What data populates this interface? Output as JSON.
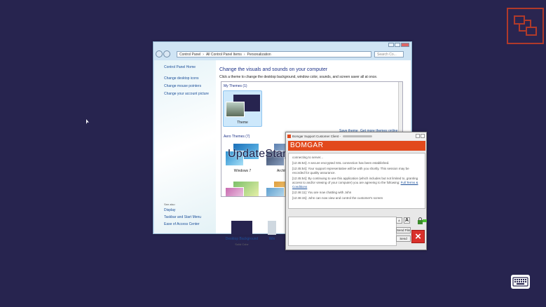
{
  "control_panel": {
    "address": [
      "Control Panel",
      "All Control Panel Items",
      "Personalization"
    ],
    "search_placeholder": "Search Co...",
    "left_links": [
      "Control Panel Home",
      "Change desktop icons",
      "Change mouse pointers",
      "Change your account picture"
    ],
    "see_also_label": "See also",
    "see_also_links": [
      "Display",
      "Taskbar and Start Menu",
      "Ease of Access Center"
    ],
    "heading": "Change the visuals and sounds on your computer",
    "subheading": "Click a theme to change the desktop background, window color, sounds, and screen saver all at once.",
    "my_themes_label": "My Themes (1)",
    "my_theme_name": "Theme",
    "save_theme": "Save theme",
    "get_more_themes": "Get more themes online",
    "aero_themes_label": "Aero Themes (7)",
    "aero_themes": [
      "Windows 7",
      "Architec"
    ],
    "bottom": [
      {
        "title": "Desktop Background",
        "subtitle": "Solid Color"
      },
      {
        "title": "Win",
        "subtitle": ""
      }
    ]
  },
  "watermark": "UpdateStar.com",
  "bomgar": {
    "title": "Bomgar Support Customer Client -",
    "brand": "BOMGAR",
    "log": [
      "connecting to server...",
      "[12:45:54]: A secure encrypted SSL connection has been established.",
      "[12:45:54]: Your support representative will be with you shortly. This session may be recorded for quality assurance.",
      "[12:45:54]: By continuing to use this application (which includes but not limited to, granting access to and/or viewing of your computer) you are agreeing to the following:",
      "[12:46:11]: You are now chatting with John",
      "[12:46:15]: John can now view and control the customer's screen"
    ],
    "terms_link": "Full Terms & Conditions",
    "send_file": "Send File",
    "send": "Send",
    "font_small": "A",
    "font_large": "A"
  },
  "colors": {
    "desktop": "#27244f",
    "bomgar_orange": "#e2491c",
    "remote_icon_border": "#b03a2a"
  },
  "icons": [
    "remote-control-icon",
    "keyboard-icon",
    "help-icon",
    "lock-icon",
    "close-icon"
  ]
}
